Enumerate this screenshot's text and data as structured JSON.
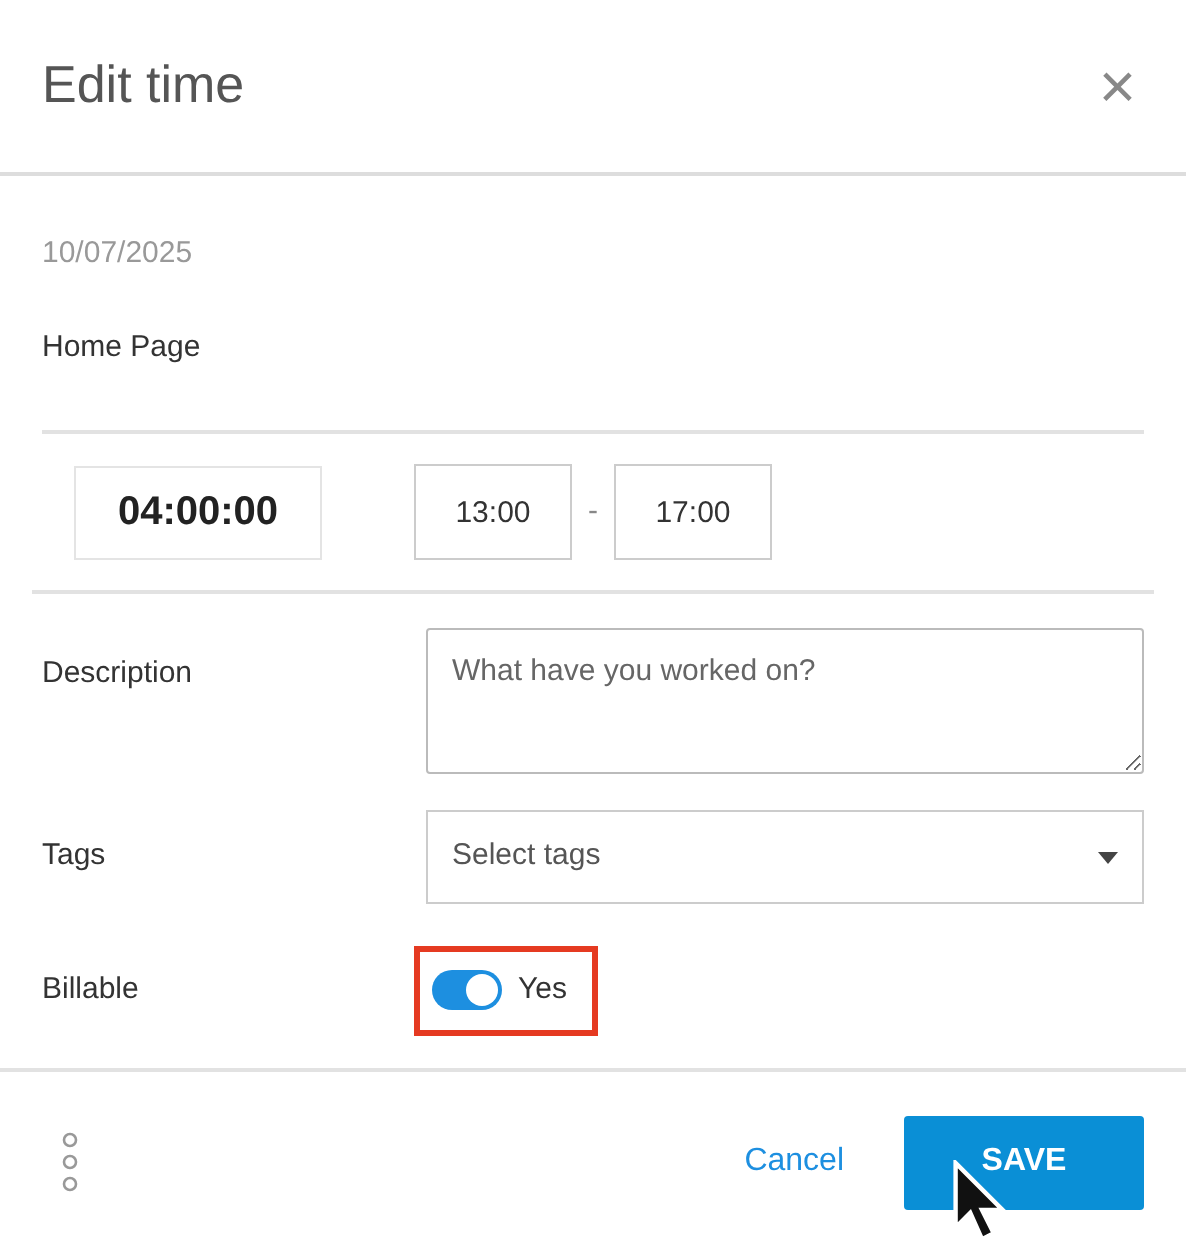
{
  "dialog": {
    "title": "Edit time",
    "close": "×"
  },
  "entry": {
    "date": "10/07/2025",
    "project": "Home Page"
  },
  "time": {
    "duration": "04:00:00",
    "start": "13:00",
    "separator": "-",
    "end": "17:00"
  },
  "fields": [
    {
      "kind": "textarea",
      "label": "Description",
      "placeholder": "What have you worked on?"
    },
    {
      "kind": "select",
      "label": "Tags",
      "placeholder": "Select tags"
    },
    {
      "kind": "toggle",
      "label": "Billable",
      "on": true,
      "text": "Yes",
      "highlighted": true
    }
  ],
  "footer": {
    "cancel": "Cancel",
    "save": "SAVE"
  }
}
